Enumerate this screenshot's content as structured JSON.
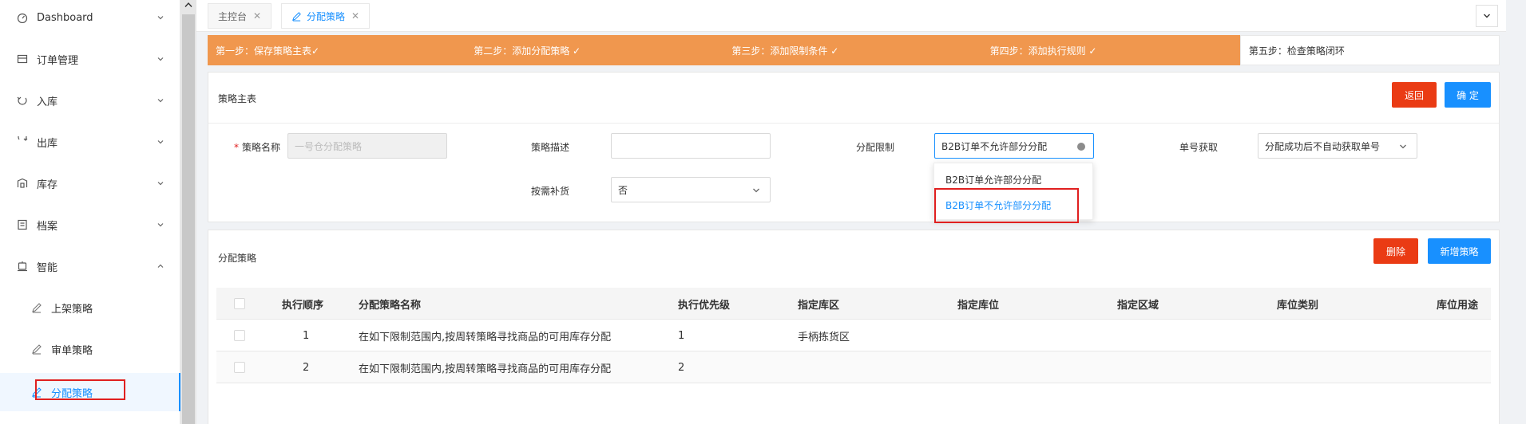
{
  "sidebar": {
    "items": [
      {
        "label": "Dashboard",
        "icon": "dashboard-icon"
      },
      {
        "label": "订单管理",
        "icon": "order-icon"
      },
      {
        "label": "入库",
        "icon": "inbound-icon"
      },
      {
        "label": "出库",
        "icon": "outbound-icon"
      },
      {
        "label": "库存",
        "icon": "inventory-icon"
      },
      {
        "label": "档案",
        "icon": "archive-icon"
      },
      {
        "label": "智能",
        "icon": "smart-icon"
      }
    ],
    "subitems": [
      {
        "label": "上架策略",
        "icon": "edit-icon"
      },
      {
        "label": "审单策略",
        "icon": "edit-icon"
      },
      {
        "label": "分配策略",
        "icon": "edit-icon"
      }
    ]
  },
  "tabs": [
    {
      "label": "主控台",
      "close": "✕"
    },
    {
      "label": "分配策略",
      "close": "✕"
    }
  ],
  "steps": [
    "第一步：保存策略主表✓",
    "第二步：添加分配策略 ✓",
    "第三步：添加限制条件 ✓",
    "第四步：添加执行规则 ✓",
    "第五步：检查策略闭环"
  ],
  "master": {
    "title": "策略主表",
    "back_label": "返回",
    "confirm_label": "确 定",
    "name_label": "策略名称",
    "name_required": "*",
    "name_value": "一号仓分配策略",
    "desc_label": "策略描述",
    "desc_value": "",
    "limit_label": "分配限制",
    "limit_value": "B2B订单不允许部分分配",
    "number_label": "单号获取",
    "number_value": "分配成功后不自动获取单号",
    "replenish_label": "按需补货",
    "replenish_value": "否",
    "dropdown_options": [
      "B2B订单允许部分分配",
      "B2B订单不允许部分分配"
    ]
  },
  "strategy": {
    "title": "分配策略",
    "delete_label": "删除",
    "add_label": "新增策略",
    "columns": [
      "执行顺序",
      "分配策略名称",
      "执行优先级",
      "指定库区",
      "指定库位",
      "指定区域",
      "库位类别",
      "库位用途"
    ],
    "rows": [
      {
        "order": "1",
        "name": "在如下限制范围内,按周转策略寻找商品的可用库存分配",
        "priority": "1",
        "zone": "手柄拣货区"
      },
      {
        "order": "2",
        "name": "在如下限制范围内,按周转策略寻找商品的可用库存分配",
        "priority": "2",
        "zone": ""
      }
    ]
  },
  "colors": {
    "accent": "#1890ff",
    "step": "#f0974e",
    "danger": "#ea3b14",
    "highlight": "#e02020"
  }
}
